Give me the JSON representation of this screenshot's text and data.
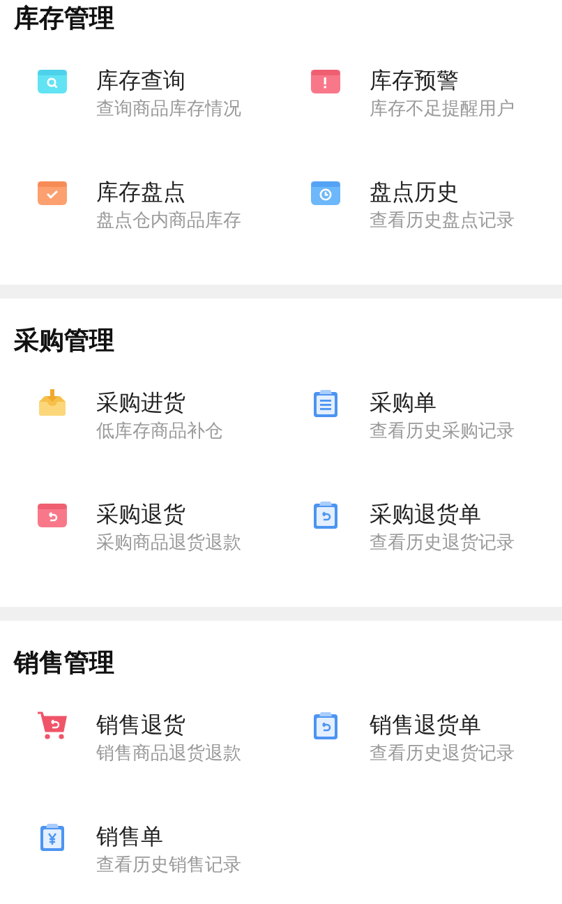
{
  "sections": [
    {
      "title": "库存管理",
      "items": [
        {
          "kind": "box-search",
          "title": "库存查询",
          "subtitle": "查询商品库存情况"
        },
        {
          "kind": "box-alert",
          "title": "库存预警",
          "subtitle": "库存不足提醒用户"
        },
        {
          "kind": "box-check",
          "title": "库存盘点",
          "subtitle": "盘点仓内商品库存"
        },
        {
          "kind": "box-clock",
          "title": "盘点历史",
          "subtitle": "查看历史盘点记录"
        }
      ]
    },
    {
      "title": "采购管理",
      "items": [
        {
          "kind": "tray-download",
          "title": "采购进货",
          "subtitle": "低库存商品补仓"
        },
        {
          "kind": "clipboard-lines",
          "title": "采购单",
          "subtitle": "查看历史采购记录"
        },
        {
          "kind": "box-return",
          "title": "采购退货",
          "subtitle": "采购商品退货退款"
        },
        {
          "kind": "clipboard-return",
          "title": "采购退货单",
          "subtitle": "查看历史退货记录"
        }
      ]
    },
    {
      "title": "销售管理",
      "items": [
        {
          "kind": "cart-return",
          "title": "销售退货",
          "subtitle": "销售商品退货退款"
        },
        {
          "kind": "clipboard-return",
          "title": "销售退货单",
          "subtitle": "查看历史退货记录"
        },
        {
          "kind": "clipboard-yen",
          "title": "销售单",
          "subtitle": "查看历史销售记录"
        }
      ]
    }
  ]
}
